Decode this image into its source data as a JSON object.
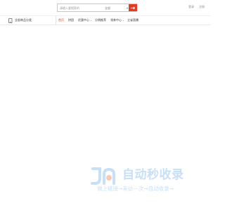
{
  "search": {
    "placeholder": "请输入要搜索的",
    "scope_label": "全部",
    "button_icon": "arrow-right-icon"
  },
  "top_links": [
    "登录",
    "注册"
  ],
  "nav": {
    "all_categories_label": "全部商品分类",
    "all_categories_icon": "phone-icon",
    "items": [
      {
        "label": "首页",
        "dropdown": false,
        "active": true
      },
      {
        "label": "拼团",
        "dropdown": false,
        "active": false
      },
      {
        "label": "优惠中心",
        "dropdown": true,
        "active": false
      },
      {
        "label": "分销推荐",
        "dropdown": false,
        "active": false
      },
      {
        "label": "领券中心",
        "dropdown": true,
        "active": false
      },
      {
        "label": "立省直播",
        "dropdown": false,
        "active": false
      }
    ]
  },
  "watermark": {
    "title": "自动秒收录",
    "slogan": "做上链接→来访一次→自动收录→"
  },
  "colors": {
    "accent": "#e43c23",
    "watermark": "#c7dff7"
  }
}
